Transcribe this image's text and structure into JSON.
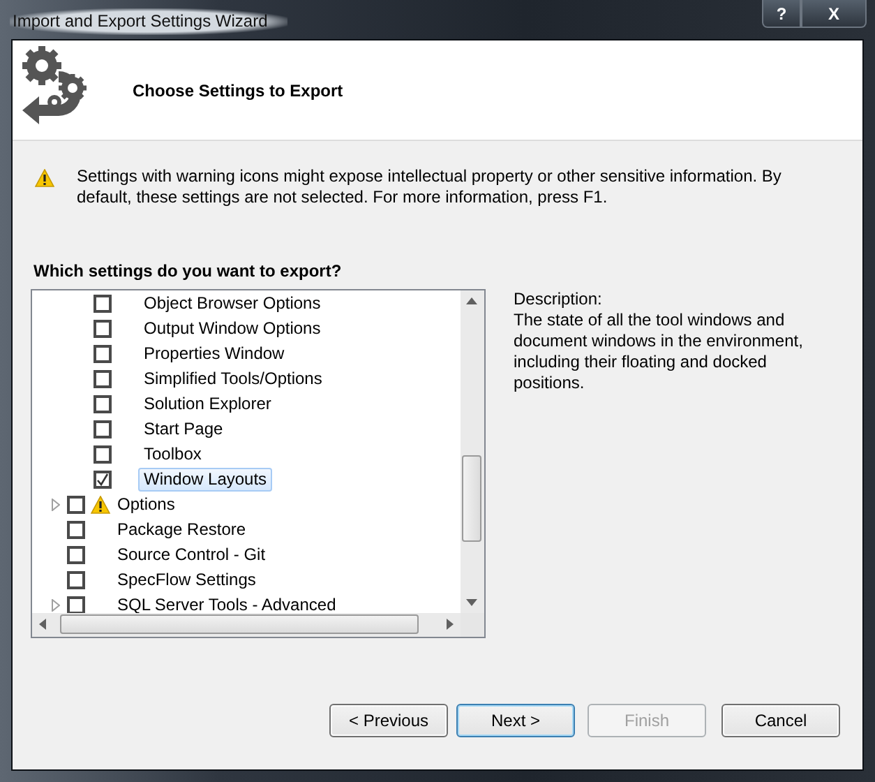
{
  "window": {
    "title": "Import and Export Settings Wizard",
    "controls": [
      "?",
      "X"
    ]
  },
  "header": {
    "title": "Choose Settings to Export"
  },
  "warning": {
    "text": "Settings with warning icons might expose intellectual property or other sensitive information. By default, these settings are not selected. For more information, press F1."
  },
  "question": "Which settings do you want to export?",
  "tree": {
    "items": [
      {
        "children": [
          {
            "label": "Object Browser Options",
            "checked": false,
            "selected": false,
            "warning": false
          },
          {
            "label": "Output Window Options",
            "checked": false,
            "selected": false,
            "warning": false
          },
          {
            "label": "Properties Window",
            "checked": false,
            "selected": false,
            "warning": false
          },
          {
            "label": "Simplified Tools/Options",
            "checked": false,
            "selected": false,
            "warning": false
          },
          {
            "label": "Solution Explorer",
            "checked": false,
            "selected": false,
            "warning": false
          },
          {
            "label": "Start Page",
            "checked": false,
            "selected": false,
            "warning": false
          },
          {
            "label": "Toolbox",
            "checked": false,
            "selected": false,
            "warning": false
          },
          {
            "label": "Window Layouts",
            "checked": true,
            "selected": true,
            "warning": false
          }
        ]
      },
      {
        "label": "Options",
        "checked": false,
        "selected": false,
        "warning": true,
        "expanded": false
      },
      {
        "label": "Package Restore",
        "checked": false,
        "selected": false,
        "warning": false
      },
      {
        "label": "Source Control - Git",
        "checked": false,
        "selected": false,
        "warning": false
      },
      {
        "label": "SpecFlow Settings",
        "checked": false,
        "selected": false,
        "warning": false
      },
      {
        "label": "SQL Server Tools - Advanced",
        "checked": false,
        "selected": false,
        "warning": false,
        "expanded": false
      }
    ]
  },
  "description": {
    "label": "Description:",
    "text": "The state of all the tool windows and document windows in the environment, including their floating and docked positions."
  },
  "buttons": [
    {
      "label": "< Previous",
      "default": false,
      "disabled": false
    },
    {
      "label": "Next >",
      "default": true,
      "disabled": false
    },
    {
      "label": "Finish",
      "default": false,
      "disabled": true
    },
    {
      "label": "Cancel",
      "default": false,
      "disabled": false
    }
  ]
}
